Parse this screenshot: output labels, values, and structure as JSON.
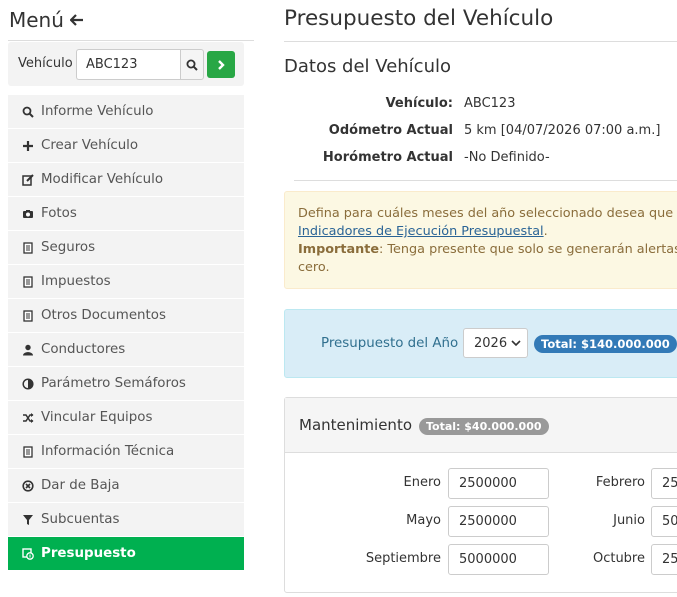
{
  "sidebar": {
    "menu_title": "Menú",
    "vehicle_label": "Vehículo",
    "vehicle_value": "ABC123",
    "items": [
      {
        "label": "Informe Vehículo",
        "icon": "search-icon"
      },
      {
        "label": "Crear Vehículo",
        "icon": "plus-icon"
      },
      {
        "label": "Modificar Vehículo",
        "icon": "edit-icon"
      },
      {
        "label": "Fotos",
        "icon": "camera-icon"
      },
      {
        "label": "Seguros",
        "icon": "document-icon"
      },
      {
        "label": "Impuestos",
        "icon": "document-icon"
      },
      {
        "label": "Otros Documentos",
        "icon": "document-icon"
      },
      {
        "label": "Conductores",
        "icon": "user-icon"
      },
      {
        "label": "Parámetro Semáforos",
        "icon": "contrast-icon"
      },
      {
        "label": "Vincular Equipos",
        "icon": "shuffle-icon"
      },
      {
        "label": "Información Técnica",
        "icon": "document-icon"
      },
      {
        "label": "Dar de Baja",
        "icon": "remove-circle-icon"
      },
      {
        "label": "Subcuentas",
        "icon": "filter-icon"
      },
      {
        "label": "Presupuesto",
        "icon": "budget-icon",
        "active": true
      }
    ]
  },
  "main": {
    "page_title": "Presupuesto del Vehículo",
    "section_title": "Datos del Vehículo",
    "details": [
      {
        "label": "Vehículo:",
        "value": "ABC123"
      },
      {
        "label": "Odómetro Actual",
        "value": "5 km [04/07/2026 07:00 a.m.]"
      },
      {
        "label": "Horómetro Actual",
        "value": "-No Definido-"
      }
    ],
    "alert": {
      "line1": "Defina para cuáles meses del año seleccionado desea que s",
      "link": "Indicadores de Ejecución Presupuestal",
      "link_suffix": ".",
      "important_label": "Importante",
      "line3": ": Tenga presente que solo se generarán alertas p",
      "line4": "cero."
    },
    "budget": {
      "label": "Presupuesto del Año",
      "year": "2026",
      "total": "Total: $140.000.000"
    },
    "maintenance": {
      "title": "Mantenimiento",
      "total": "Total: $40.000.000",
      "months": [
        {
          "label": "Enero",
          "value": "2500000"
        },
        {
          "label": "Febrero",
          "value": "25"
        },
        {
          "label": "Mayo",
          "value": "2500000"
        },
        {
          "label": "Junio",
          "value": "50"
        },
        {
          "label": "Septiembre",
          "value": "5000000"
        },
        {
          "label": "Octubre",
          "value": "25"
        }
      ]
    }
  },
  "colors": {
    "active_nav": "#00b050",
    "go_button": "#28a745",
    "info_bg": "#d9edf7",
    "warning_bg": "#fcf8e3",
    "total_badge": "#337ab7"
  }
}
